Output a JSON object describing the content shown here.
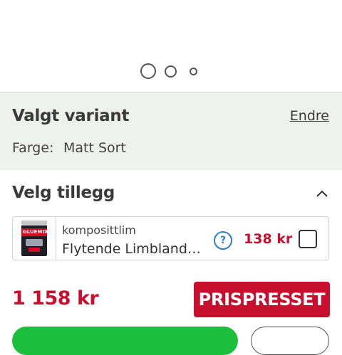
{
  "carousel": {
    "total_slides": 3,
    "active_slide": 1
  },
  "variant": {
    "title": "Valgt variant",
    "change_link": "Endre",
    "color_label": "Farge:",
    "color_value": "Matt Sort"
  },
  "addons": {
    "title": "Velg tillegg",
    "items": [
      {
        "category": "komposittlim",
        "name": "Flytende Limblandin...",
        "price": "138 kr",
        "thumbnail_brand": "GLUEMIX",
        "checked": false
      }
    ]
  },
  "product": {
    "price": "1 158 kr",
    "badge": "PRISPRESSET"
  },
  "colors": {
    "price_red": "#c8102e",
    "buy_green": "#1bbf3b",
    "variant_bg": "#eef2ef",
    "help_blue": "#2f7ec8"
  }
}
